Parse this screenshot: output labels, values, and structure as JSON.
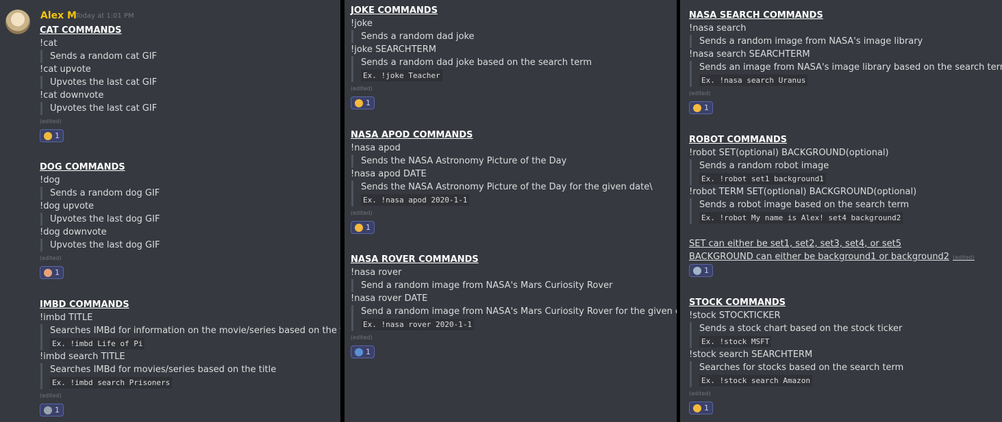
{
  "author": {
    "name": "Alex M",
    "timestamp": "Today at 1:01 PM"
  },
  "edited_label": "(edited)",
  "cat": {
    "heading": "CAT COMMANDS",
    "cmd1": "!cat",
    "desc1": "Sends a random cat GIF",
    "cmd2": "!cat upvote",
    "desc2": "Upvotes the last cat GIF",
    "cmd3": "!cat downvote",
    "desc3": "Upvotes the last cat GIF",
    "reaction": {
      "emoji": "smiling-cat-emoji",
      "count": "1",
      "color": "#f0b93a"
    }
  },
  "dog": {
    "heading": "DOG COMMANDS",
    "cmd1": "!dog",
    "desc1": "Sends a random dog GIF",
    "cmd2": "!dog upvote",
    "desc2": "Upvotes the last dog GIF",
    "cmd3": "!dog downvote",
    "desc3": "Upvotes the last dog GIF",
    "reaction": {
      "emoji": "dog-face-emoji",
      "count": "1",
      "color": "#e8a27a"
    }
  },
  "imbd": {
    "heading": "IMBD COMMANDS",
    "cmd1": "!imbd TITLE",
    "desc1": "Searches IMBd for information on the movie/series based on the title",
    "ex1": "Ex. !imbd Life of Pi",
    "cmd2": "!imbd search TITLE",
    "desc2": "Searches IMBd for movies/series based on the title",
    "ex2": "Ex. !imbd search Prisoners",
    "reaction": {
      "emoji": "movie-camera-emoji",
      "count": "1",
      "color": "#9aa3ad"
    }
  },
  "joke": {
    "heading": "JOKE COMMANDS",
    "cmd1": "!joke",
    "desc1": "Sends a random dad joke",
    "cmd2": "!joke SEARCHTERM",
    "desc2": "Sends a random dad joke based on the search term",
    "ex2": "Ex. !joke Teacher",
    "reaction": {
      "emoji": "joy-emoji",
      "count": "1",
      "color": "#f5b93d"
    }
  },
  "apod": {
    "heading": "NASA APOD COMMANDS",
    "cmd1": "!nasa apod",
    "desc1": "Sends the NASA Astronomy Picture of the Day",
    "cmd2": "!nasa apod DATE",
    "desc2": "Sends the NASA Astronomy Picture of the Day for the given date\\",
    "ex2": "Ex. !nasa apod 2020-1-1",
    "reaction": {
      "emoji": "nerd-face-emoji",
      "count": "1",
      "color": "#f5b93d"
    }
  },
  "rover": {
    "heading": "NASA ROVER COMMANDS",
    "cmd1": "!nasa rover",
    "desc1": "Send a random image from NASA's Mars Curiosity Rover",
    "cmd2": "!nasa rover DATE",
    "desc2": "Send a random image from NASA's Mars Curiosity Rover for the given date",
    "ex2": "Ex. !nasa rover 2020-1-1",
    "reaction": {
      "emoji": "car-emoji",
      "count": "1",
      "color": "#5b8fd6"
    }
  },
  "nasasearch": {
    "heading": "NASA SEARCH COMMANDS",
    "cmd1": "!nasa search",
    "desc1": "Sends a random image from NASA's image library",
    "cmd2": "!nasa search SEARCHTERM",
    "desc2": "Sends an image from NASA's image library based on the search term",
    "ex2": "Ex. !nasa search Uranus",
    "reaction": {
      "emoji": "thinking-face-emoji",
      "count": "1",
      "color": "#f5b93d"
    }
  },
  "robot": {
    "heading": "ROBOT COMMANDS",
    "cmd1": "!robot SET(optional) BACKGROUND(optional)",
    "desc1": "Sends a random robot image",
    "ex1": "Ex. !robot set1 background1",
    "cmd2": "!robot TERM SET(optional) BACKGROUND(optional)",
    "desc2": "Sends a robot image based on the search term",
    "ex2": "Ex. !robot My name is Alex! set4 background2",
    "note1": "SET can either be set1, set2, set3, set4, or set5",
    "note2": "BACKGROUND can either be background1 or background2",
    "reaction": {
      "emoji": "robot-emoji",
      "count": "1",
      "color": "#9fb4c7"
    }
  },
  "stock": {
    "heading": "STOCK COMMANDS",
    "cmd1": "!stock STOCKTICKER",
    "desc1": "Sends a stock chart based on the stock ticker",
    "ex1": "Ex. !stock MSFT",
    "cmd2": "!stock search SEARCHTERM",
    "desc2": "Searches for stocks based on the search term",
    "ex2": "Ex. !stock search Amazon",
    "reaction": {
      "emoji": "money-mouth-face-emoji",
      "count": "1",
      "color": "#f5b93d"
    }
  }
}
